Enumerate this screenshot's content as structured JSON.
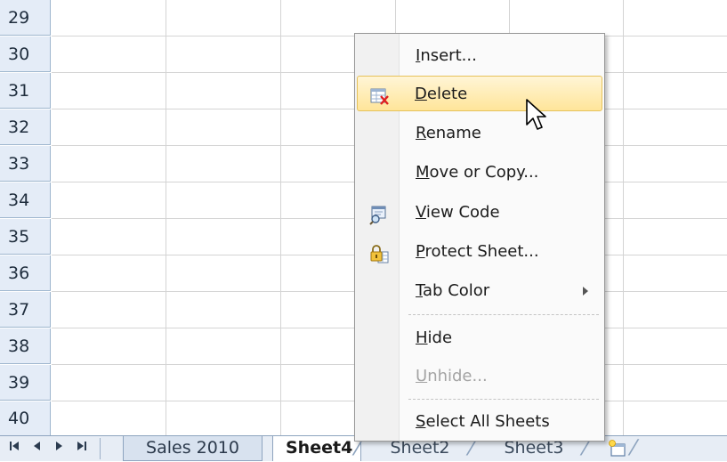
{
  "grid": {
    "rows": [
      "29",
      "30",
      "31",
      "32",
      "33",
      "34",
      "35",
      "36",
      "37",
      "38",
      "39",
      "40"
    ]
  },
  "tabs": {
    "sheets": [
      {
        "label": "Sales 2010",
        "active": false
      },
      {
        "label": "Sheet4",
        "active": true
      },
      {
        "label": "Sheet2",
        "active": false
      },
      {
        "label": "Sheet3",
        "active": false
      }
    ],
    "nav_icons": [
      "first-sheet-icon",
      "prev-sheet-icon",
      "next-sheet-icon",
      "last-sheet-icon"
    ],
    "new_sheet_icon": "insert-worksheet-icon"
  },
  "context_menu": {
    "items": [
      {
        "label": "Insert...",
        "accel": "I",
        "icon": null,
        "state": "normal"
      },
      {
        "label": "Delete",
        "accel": "D",
        "icon": "delete-sheet-icon",
        "state": "hover"
      },
      {
        "label": "Rename",
        "accel": "R",
        "icon": null,
        "state": "normal"
      },
      {
        "label": "Move or Copy...",
        "accel": "M",
        "icon": null,
        "state": "normal"
      },
      {
        "label": "View Code",
        "accel": "V",
        "icon": "view-code-icon",
        "state": "normal"
      },
      {
        "label": "Protect Sheet...",
        "accel": "P",
        "icon": "protect-sheet-icon",
        "state": "normal"
      },
      {
        "label": "Tab Color",
        "accel": "T",
        "icon": null,
        "state": "normal",
        "submenu": true
      },
      {
        "label": "Hide",
        "accel": "H",
        "icon": null,
        "state": "normal"
      },
      {
        "label": "Unhide...",
        "accel": "U",
        "icon": null,
        "state": "disabled"
      },
      {
        "label": "Select All Sheets",
        "accel": "S",
        "icon": null,
        "state": "normal"
      }
    ]
  },
  "colors": {
    "row_header_bg": "#e4ecf7",
    "gridline": "#d4d4d4",
    "menu_hover": "#ffe59a",
    "tabbar_bg": "#e7edf5"
  }
}
